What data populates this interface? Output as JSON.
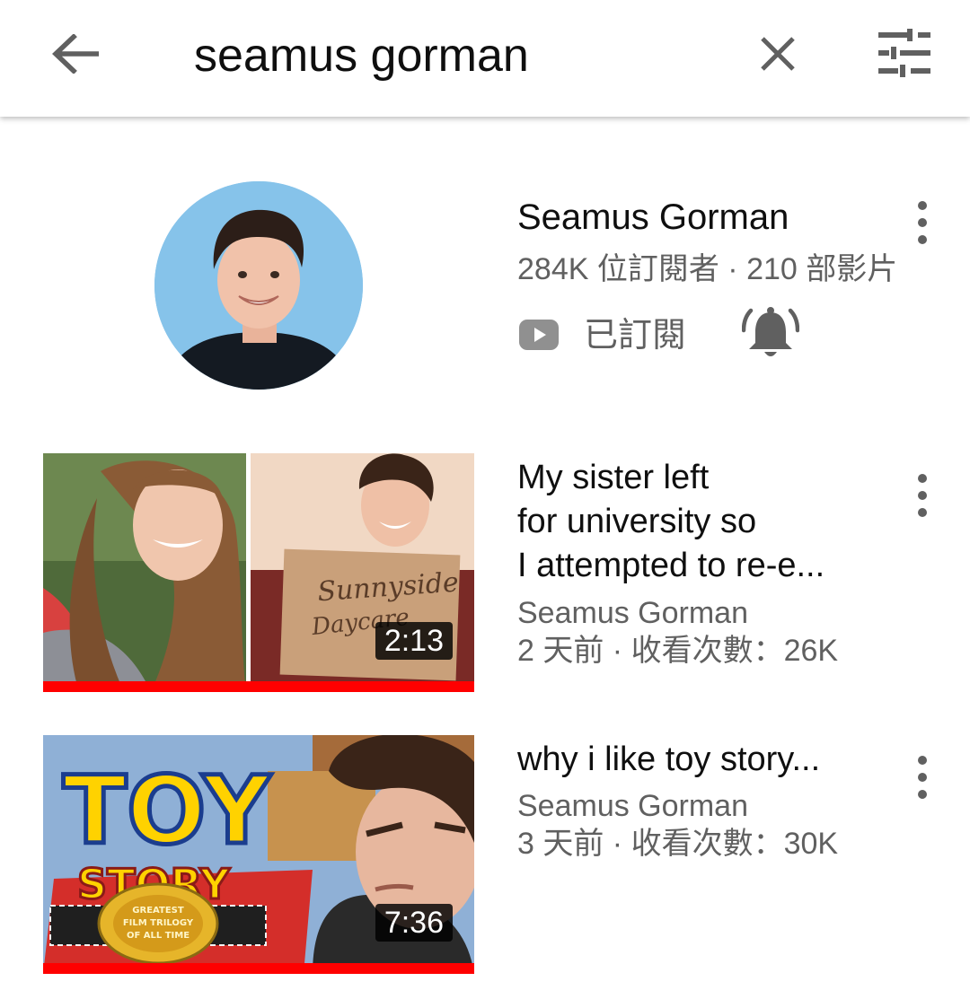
{
  "search": {
    "query": "seamus gorman"
  },
  "icons": {
    "back": "arrow-left-icon",
    "clear": "close-icon",
    "filter": "filter-sliders-icon",
    "more": "more-vertical-icon",
    "subscribed": "youtube-play-icon",
    "notifications": "bell-ringing-icon"
  },
  "colors": {
    "progress": "#ff0000",
    "secondary_text": "#606060",
    "avatar_bg": "#86c3ea"
  },
  "channel": {
    "name": "Seamus Gorman",
    "stats": "284K 位訂閱者 · 210 部影片",
    "subscribed_label": "已訂閱"
  },
  "videos": [
    {
      "title_lines": [
        "My sister left",
        "for university so",
        "I attempted to re-e..."
      ],
      "channel": "Seamus Gorman",
      "meta": "2 天前 · 收看次數：26K",
      "duration": "2:13",
      "thumbnail_sign": [
        "Sunnyside",
        "Daycare"
      ],
      "watch_progress": 1.0
    },
    {
      "title_lines": [
        "why i like toy story..."
      ],
      "channel": "Seamus Gorman",
      "meta": "3 天前 · 收看次數：30K",
      "duration": "7:36",
      "thumbnail_logo": [
        "TOY",
        "STORY"
      ],
      "thumbnail_belt": [
        "GREATEST",
        "FILM TRILOGY",
        "OF ALL TIME"
      ],
      "watch_progress": 1.0
    }
  ]
}
